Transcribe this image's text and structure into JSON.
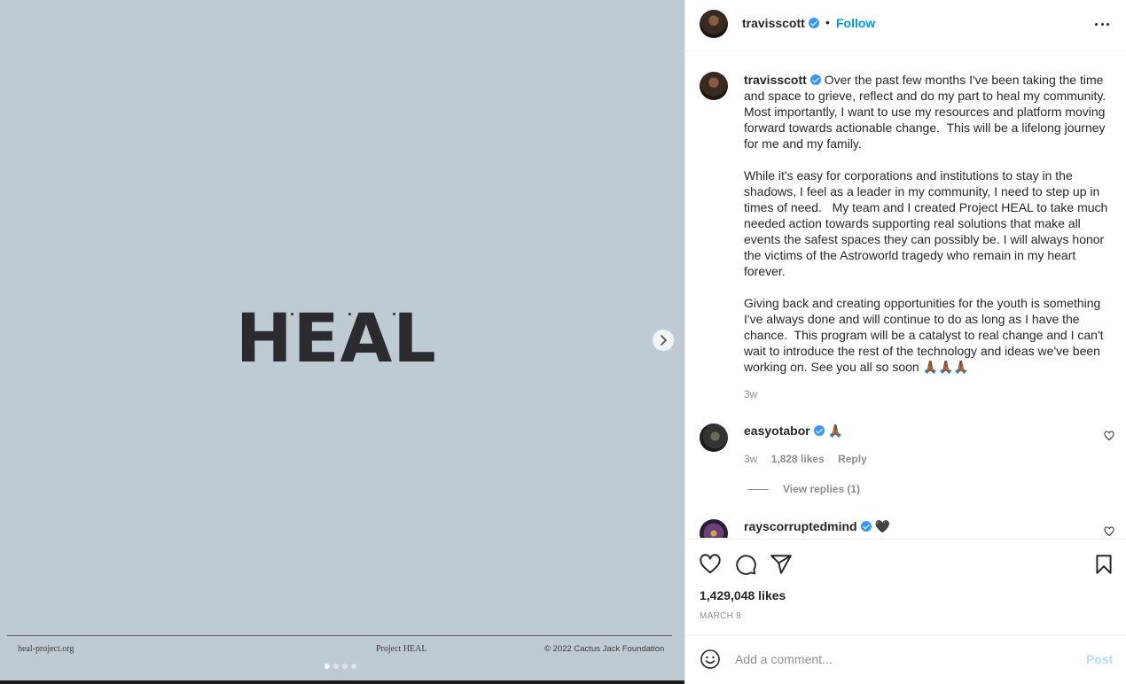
{
  "media": {
    "logo_text": "HEAL",
    "footer_left": "heal-project.org",
    "footer_center": "Project HEAL",
    "footer_right": "© 2022 Cactus Jack Foundation",
    "carousel": {
      "count": 4,
      "active_index": 0
    },
    "background_color": "#bfcbd3",
    "next_icon": "chevron-right-icon"
  },
  "header": {
    "username": "travisscott",
    "separator": "•",
    "follow_label": "Follow",
    "more_icon": "more-options-icon"
  },
  "caption": {
    "username": "travisscott",
    "text": "Over the past few months I've been taking the time and space to grieve, reflect and do my part to heal my community.  Most importantly, I want to use my resources and platform moving forward towards actionable change.  This will be a lifelong journey for me and my family.\n\nWhile it's easy for corporations and institutions to stay in the shadows, I feel as a leader in my community, I need to step up in times of need.   My team and I created Project HEAL to take much needed action towards supporting real solutions that make all events the safest spaces they can possibly be. I will always honor the victims of the Astroworld tragedy who remain in my heart forever.\n\nGiving back and creating opportunities for the youth is something I've always done and will continue to do as long as I have the chance.  This program will be a catalyst to real change and I can't wait to introduce the rest of the technology and ideas we've been working on. See you all so soon 🙏🏾🙏🏾🙏🏾",
    "time": "3w"
  },
  "comments": [
    {
      "username": "easyotabor",
      "text": "🙏🏾",
      "time": "3w",
      "likes": "1,828 likes",
      "reply_label": "Reply",
      "view_replies": "View replies (1)"
    },
    {
      "username": "rayscorruptedmind",
      "text": "🖤"
    }
  ],
  "actions": {
    "likes": "1,429,048 likes",
    "date": "MARCH 8"
  },
  "comment_box": {
    "placeholder": "Add a comment...",
    "post_label": "Post"
  },
  "colors": {
    "accent": "#0095f6",
    "verified": "#3897f0",
    "muted": "#8e8e8e"
  }
}
